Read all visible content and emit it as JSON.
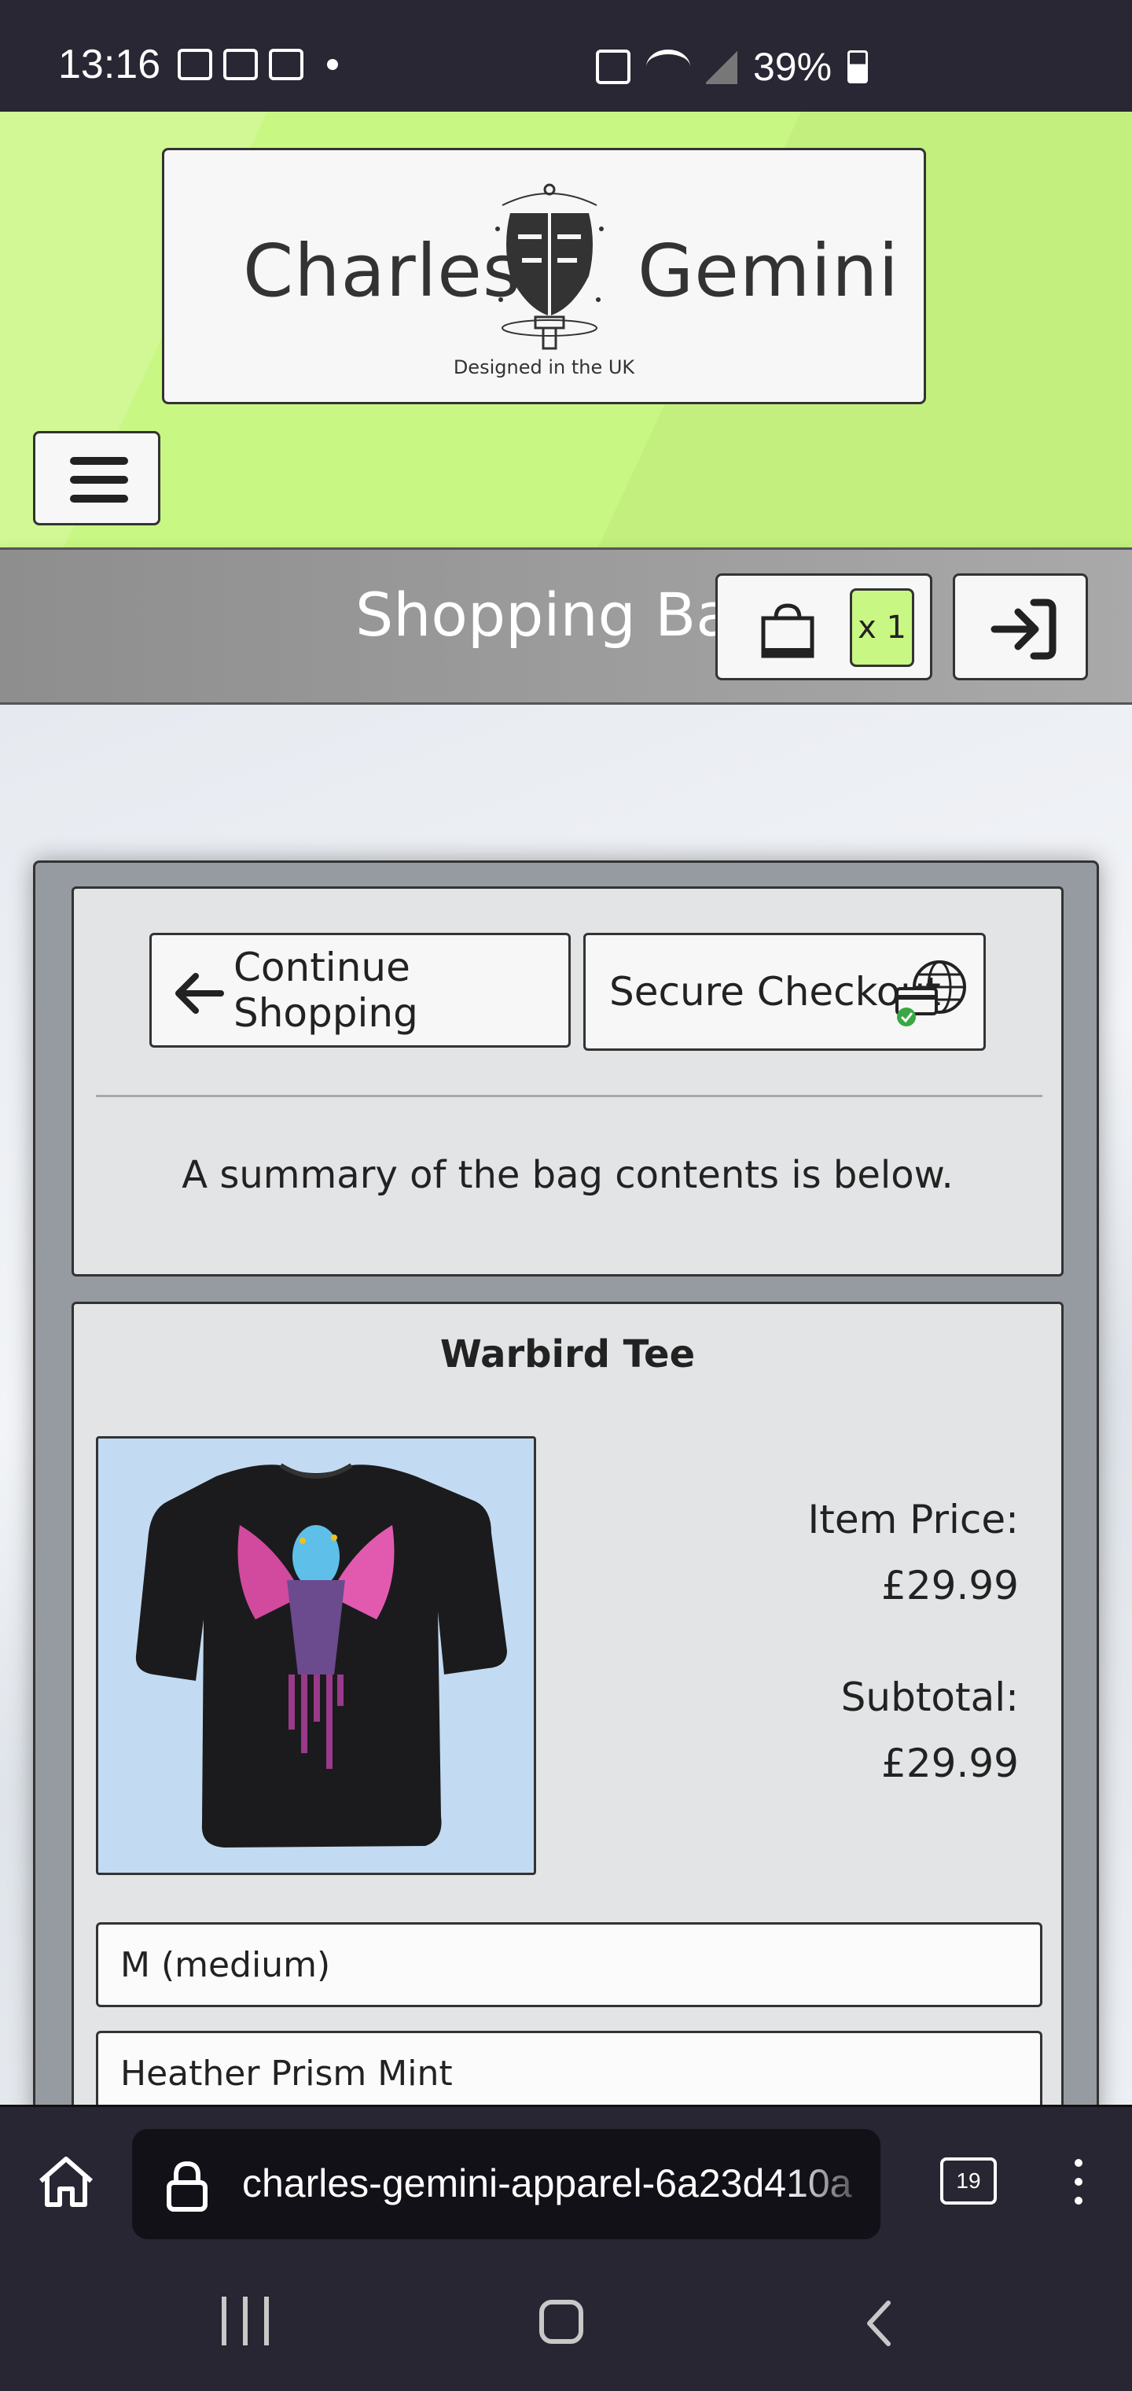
{
  "status_bar": {
    "time": "13:16",
    "battery": "39%",
    "icons": [
      "gallery-icon",
      "gmail-icon",
      "mail-icon",
      "notification-dot-icon",
      "nfc-icon",
      "wifi-icon",
      "signal-icon",
      "battery-icon"
    ]
  },
  "header": {
    "brand_left": "Charles",
    "brand_right": "Gemini",
    "tagline": "Designed in the UK",
    "accent_color": "#c9f783"
  },
  "bag_bar": {
    "title": "Shopping Bag",
    "count": "x 1"
  },
  "actions": {
    "continue_label": "Continue Shopping",
    "checkout_label": "Secure Checkout",
    "summary": "A summary of the bag contents is below."
  },
  "item": {
    "name": "Warbird Tee",
    "price_label": "Item Price:",
    "price": "£29.99",
    "subtotal_label": "Subtotal:",
    "subtotal": "£29.99",
    "size": "M (medium)",
    "color": "Heather Prism Mint"
  },
  "browser": {
    "url": "charles-gemini-apparel-6a23d410a",
    "tab_count": "19"
  }
}
